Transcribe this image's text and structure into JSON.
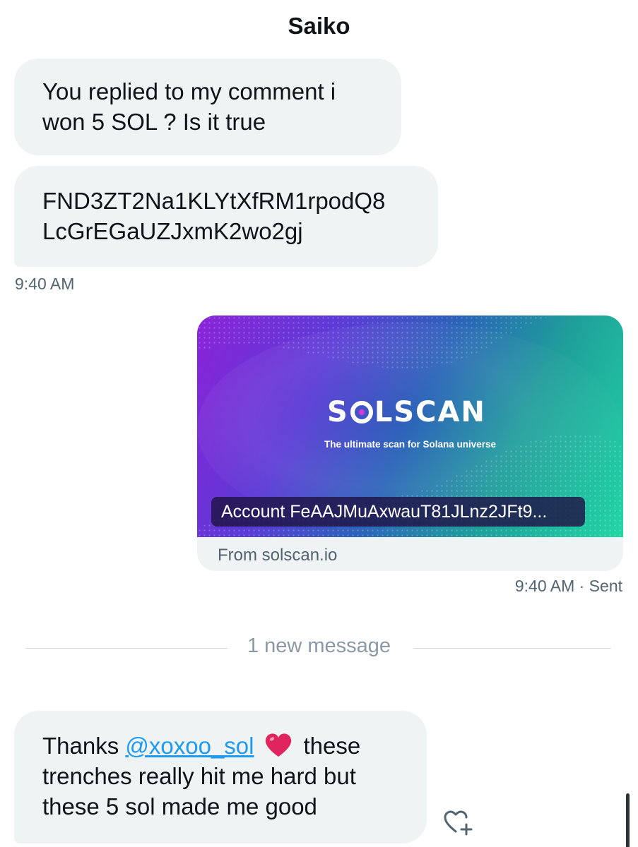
{
  "header": {
    "title": "Saiko"
  },
  "messages": {
    "m1": {
      "lines": [
        "You replied to my comment i",
        "won 5 SOL ? Is it true"
      ]
    },
    "m2": {
      "lines": [
        "FND3ZT2Na1KLYtXfRM1rpodQ8",
        "LcGrEGaUZJxmK2wo2gj"
      ]
    },
    "time_received": "9:40 AM",
    "card": {
      "brand_left": "S",
      "brand_right": "LSCAN",
      "tagline": "The ultimate scan for Solana universe",
      "account": "Account FeAAJMuAxwauT81JLnz2JFt9...",
      "source": "From solscan.io"
    },
    "time_sent": "9:40 AM · Sent",
    "divider": "1 new message",
    "m3": {
      "line1_pre": "Thanks ",
      "mention": "@xoxoo_sol",
      "line1_post": "these",
      "line2": "trenches really hit me hard but",
      "line3": "these 5 sol made me good"
    }
  },
  "icons": {
    "heart": "red-heart-emoji",
    "react": "heart-plus-icon"
  },
  "colors": {
    "bubble_in": "#eff3f4",
    "mention": "#1d9bf0",
    "muted": "#536471",
    "heart": "#e0245e"
  }
}
